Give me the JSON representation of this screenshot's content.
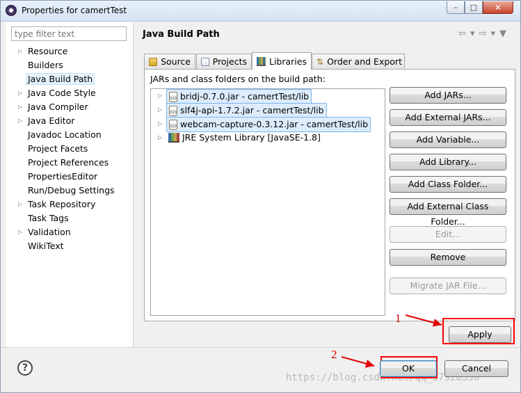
{
  "window": {
    "title": "Properties for camertTest",
    "controls": [
      "–",
      "□",
      "✕"
    ]
  },
  "sidebar": {
    "filter_placeholder": "type filter text",
    "items": [
      {
        "label": "Resource",
        "expandable": true
      },
      {
        "label": "Builders",
        "expandable": false
      },
      {
        "label": "Java Build Path",
        "expandable": false,
        "selected": true
      },
      {
        "label": "Java Code Style",
        "expandable": true
      },
      {
        "label": "Java Compiler",
        "expandable": true
      },
      {
        "label": "Java Editor",
        "expandable": true
      },
      {
        "label": "Javadoc Location",
        "expandable": false
      },
      {
        "label": "Project Facets",
        "expandable": false
      },
      {
        "label": "Project References",
        "expandable": false
      },
      {
        "label": "PropertiesEditor",
        "expandable": false
      },
      {
        "label": "Run/Debug Settings",
        "expandable": false
      },
      {
        "label": "Task Repository",
        "expandable": true
      },
      {
        "label": "Task Tags",
        "expandable": false
      },
      {
        "label": "Validation",
        "expandable": true
      },
      {
        "label": "WikiText",
        "expandable": false
      }
    ]
  },
  "main": {
    "title": "Java Build Path",
    "nav_arrows": "⇦▾⇨▾▼",
    "tabs": [
      {
        "label": "Source",
        "icon": "source-folder-icon"
      },
      {
        "label": "Projects",
        "icon": "projects-folder-icon"
      },
      {
        "label": "Libraries",
        "icon": "libraries-icon",
        "active": true
      },
      {
        "label": "Order and Export",
        "icon": "order-export-icon"
      }
    ],
    "panel_label": "JARs and class folders on the build path:",
    "libraries": [
      {
        "label": "bridj-0.7.0.jar - camertTest/lib",
        "selected": true,
        "icon": "jar-icon"
      },
      {
        "label": "slf4j-api-1.7.2.jar - camertTest/lib",
        "selected": true,
        "icon": "jar-icon"
      },
      {
        "label": "webcam-capture-0.3.12.jar - camertTest/lib",
        "selected": true,
        "icon": "jar-icon"
      },
      {
        "label": "JRE System Library [JavaSE-1.8]",
        "selected": false,
        "icon": "jre-library-icon"
      }
    ],
    "buttons": [
      {
        "label": "Add JARs...",
        "enabled": true
      },
      {
        "label": "Add External JARs...",
        "enabled": true
      },
      {
        "label": "Add Variable...",
        "enabled": true
      },
      {
        "label": "Add Library...",
        "enabled": true
      },
      {
        "label": "Add Class Folder...",
        "enabled": true
      },
      {
        "label": "Add External Class Folder...",
        "enabled": true
      },
      {
        "label": "Edit...",
        "enabled": false
      },
      {
        "label": "Remove",
        "enabled": true
      },
      {
        "label": "Migrate JAR File...",
        "enabled": false
      }
    ],
    "apply_label": "Apply"
  },
  "footer": {
    "help_label": "?",
    "ok_label": "OK",
    "cancel_label": "Cancel"
  },
  "annotations": {
    "step1": "1",
    "step2": "2",
    "highlight_color": "#ff0000"
  },
  "watermark": "https://blog.csdn.net/qq_37928350"
}
